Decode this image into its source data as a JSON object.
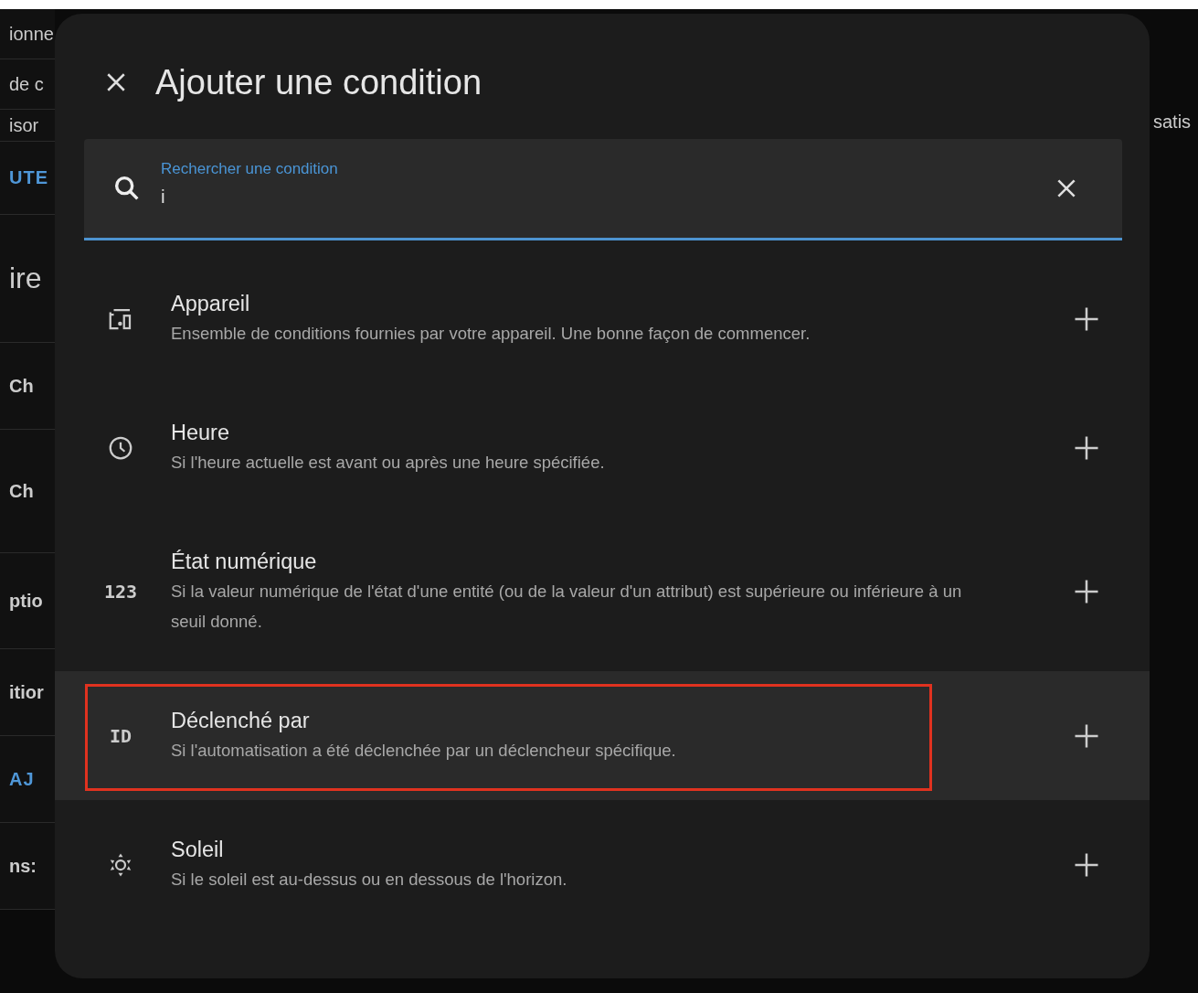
{
  "background": {
    "left_fragments": [
      {
        "text": "ionne",
        "kind": "plain"
      },
      {
        "text": "de c",
        "kind": "plain"
      },
      {
        "text": "isor",
        "kind": "plain"
      },
      {
        "text": "UTE",
        "kind": "link"
      },
      {
        "text": "ire",
        "kind": "heading"
      },
      {
        "text": "Ch",
        "kind": "bold"
      },
      {
        "text": "Ch",
        "kind": "bold"
      },
      {
        "text": "ptio",
        "kind": "bold"
      },
      {
        "text": "itior",
        "kind": "bold"
      },
      {
        "text": "AJ",
        "kind": "link"
      },
      {
        "text": "ns:",
        "kind": "bold"
      }
    ],
    "right_fragments": [
      {
        "text": "satis"
      }
    ]
  },
  "dialog": {
    "title": "Ajouter une condition",
    "search": {
      "label": "Rechercher une condition",
      "value": "i"
    },
    "items": [
      {
        "title": "Appareil",
        "description": "Ensemble de conditions fournies par votre appareil. Une bonne façon de commencer.",
        "icon": {
          "kind": "device"
        },
        "highlighted": false,
        "outlined": false
      },
      {
        "title": "Heure",
        "description": "Si l'heure actuelle est avant ou après une heure spécifiée.",
        "icon": {
          "kind": "clock"
        },
        "highlighted": false,
        "outlined": false
      },
      {
        "title": "État numérique",
        "description": "Si la valeur numérique de l'état d'une entité (ou de la valeur d'un attribut) est supérieure ou inférieure à un seuil donné.",
        "icon": {
          "kind": "glyph",
          "text": "123"
        },
        "highlighted": false,
        "outlined": false
      },
      {
        "title": "Déclenché par",
        "description": "Si l'automatisation a été déclenchée par un déclencheur spécifique.",
        "icon": {
          "kind": "glyph",
          "text": "ID"
        },
        "highlighted": true,
        "outlined": true
      },
      {
        "title": "Soleil",
        "description": "Si le soleil est au-dessus ou en dessous de l'horizon.",
        "icon": {
          "kind": "sun"
        },
        "highlighted": false,
        "outlined": false
      }
    ]
  }
}
